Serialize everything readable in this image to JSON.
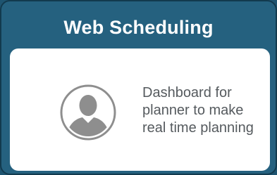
{
  "tile": {
    "title": "Web Scheduling",
    "description_lines": [
      "Dashboard for",
      "planner to make",
      "real time planning"
    ],
    "icon": "user-avatar-icon",
    "colors": {
      "header_bg": "#25617f",
      "border": "#123a4e",
      "card_bg": "#ffffff",
      "text": "#555a5e",
      "avatar_gray": "#8e8e8e"
    }
  }
}
